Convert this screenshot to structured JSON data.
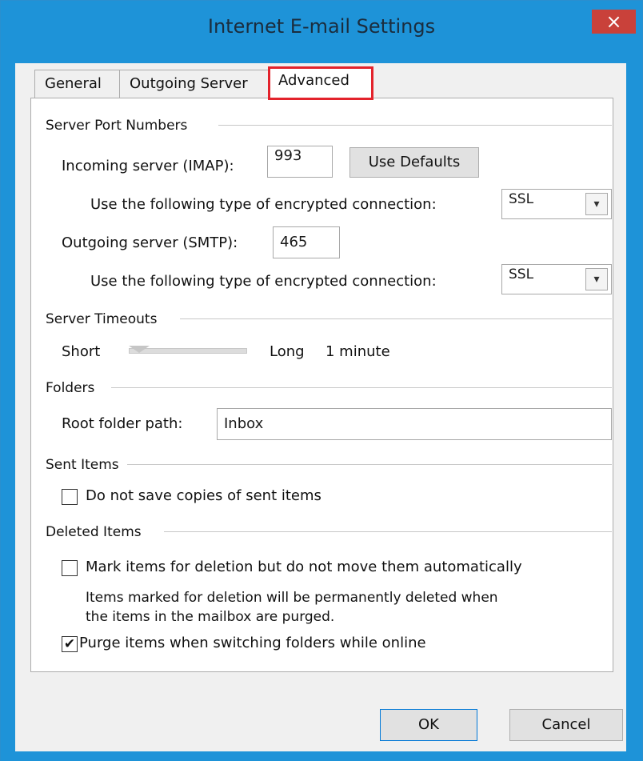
{
  "window": {
    "title": "Internet E-mail Settings",
    "close_glyph": "×"
  },
  "tabs": [
    {
      "label": "General"
    },
    {
      "label": "Outgoing Server"
    },
    {
      "label": "Advanced"
    }
  ],
  "server_ports": {
    "heading": "Server Port Numbers",
    "incoming_label": "Incoming server (IMAP):",
    "incoming_port": "993",
    "use_defaults": "Use Defaults",
    "encryption_label": "Use the following type of encrypted connection:",
    "incoming_encryption": "SSL",
    "outgoing_label": "Outgoing server (SMTP):",
    "outgoing_port": "465",
    "outgoing_encryption": "SSL"
  },
  "timeouts": {
    "heading": "Server Timeouts",
    "short": "Short",
    "long": "Long",
    "value": "1 minute"
  },
  "folders": {
    "heading": "Folders",
    "root_label": "Root folder path:",
    "root_value": "Inbox"
  },
  "sent_items": {
    "heading": "Sent Items",
    "no_save_label": "Do not save copies of sent items",
    "no_save_checked": false
  },
  "deleted_items": {
    "heading": "Deleted Items",
    "mark_label": "Mark items for deletion but do not move them automatically",
    "mark_checked": false,
    "note_line1": "Items marked for deletion will be permanently deleted when",
    "note_line2": "the items in the mailbox are purged.",
    "purge_label": "Purge items when switching folders while online",
    "purge_checked": true
  },
  "buttons": {
    "ok": "OK",
    "cancel": "Cancel"
  },
  "icons": {
    "dropdown": "chevron-down-icon",
    "check": "check-icon",
    "close": "close-icon"
  },
  "colors": {
    "frame": "#1e93d8",
    "close": "#c9413a",
    "highlight": "#e3232c"
  }
}
